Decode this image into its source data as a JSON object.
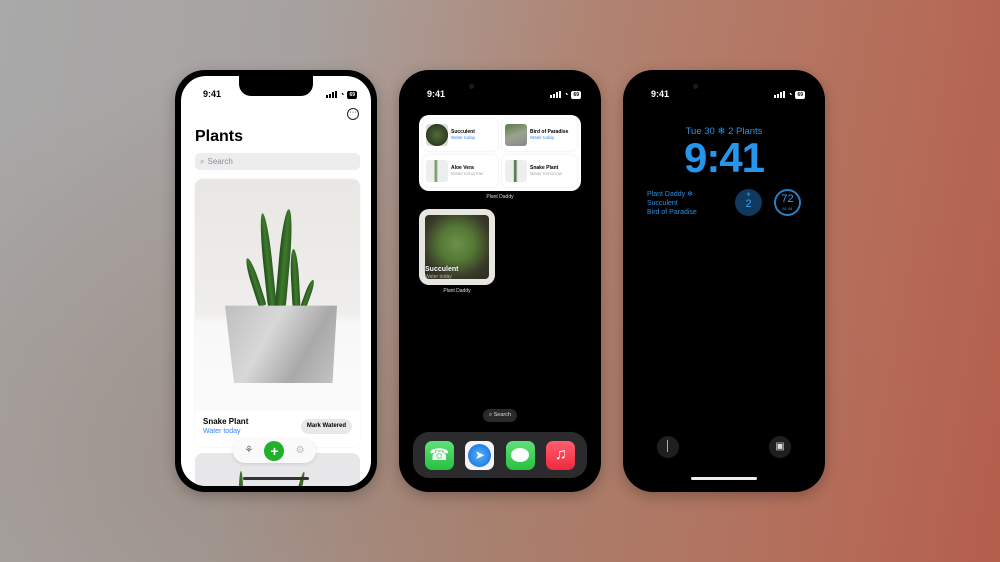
{
  "status_bar": {
    "time": "9:41",
    "battery": "69"
  },
  "app_screen": {
    "title": "Plants",
    "search_placeholder": "Search",
    "more_icon": "ellipsis-circle-icon",
    "featured_plant": {
      "name": "Snake Plant",
      "status": "Water today",
      "action_label": "Mark Watered"
    },
    "tab_bar": {
      "items": [
        {
          "icon": "plant-pot-icon",
          "label": "Plants"
        },
        {
          "icon": "plus-icon",
          "label": "Add"
        },
        {
          "icon": "gear-icon",
          "label": "Settings"
        }
      ]
    }
  },
  "home_screen": {
    "large_widget": {
      "items": [
        {
          "name": "Succulent",
          "status": "Water today",
          "urgent": true
        },
        {
          "name": "Bird of Paradise",
          "status": "Water today",
          "urgent": true
        },
        {
          "name": "Aloe Vera",
          "status": "Water tomorrow",
          "urgent": false
        },
        {
          "name": "Snake Plant",
          "status": "Water tomorrow",
          "urgent": false
        }
      ],
      "label": "Plant Daddy"
    },
    "small_widget": {
      "name": "Succulent",
      "status": "Water today",
      "label": "Plant Daddy"
    },
    "search_label": "Search",
    "dock": [
      {
        "app": "Phone",
        "icon": "phone-icon",
        "color": "#34c759"
      },
      {
        "app": "Safari",
        "icon": "compass-icon",
        "color": "#1e88e5"
      },
      {
        "app": "Messages",
        "icon": "message-bubble-icon",
        "color": "#34c759"
      },
      {
        "app": "Music",
        "icon": "music-note-icon",
        "color": "#fc3c44"
      }
    ]
  },
  "lock_screen": {
    "date_line": "Tue 30",
    "plants_count_label": "2 Plants",
    "clock": "9:41",
    "widget": {
      "title": "Plant Daddy",
      "lines": [
        "Succulent",
        "Bird of Paradise"
      ]
    },
    "count_circle": "2",
    "weather": {
      "temp": "72",
      "low": "61",
      "high": "94"
    },
    "accent": "#2596eb"
  }
}
